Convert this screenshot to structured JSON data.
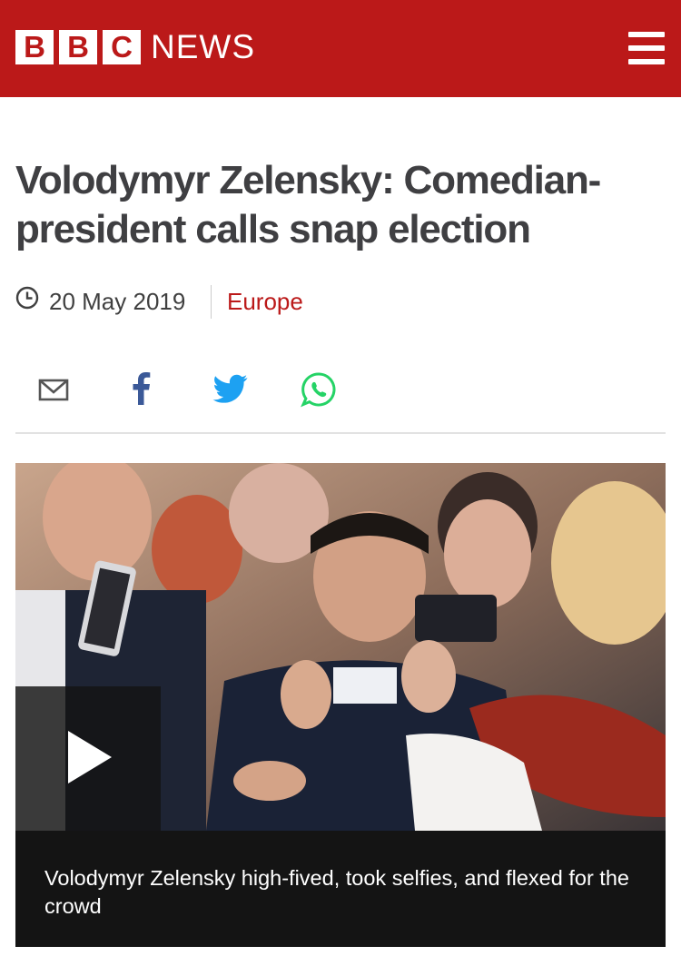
{
  "header": {
    "logo_letters": [
      "B",
      "B",
      "C"
    ],
    "logo_word": "NEWS",
    "menu_icon": "hamburger-menu-icon",
    "background_color": "#bb1919"
  },
  "article": {
    "headline": "Volodymyr Zelensky: Comedian-president calls snap election",
    "date": "20 May 2019",
    "section": "Europe",
    "date_icon": "clock-icon"
  },
  "share": {
    "icons": [
      "email-icon",
      "facebook-icon",
      "twitter-icon",
      "whatsapp-icon"
    ],
    "colors": {
      "facebook": "#3b5998",
      "twitter": "#1da1f2",
      "whatsapp": "#25d366",
      "email": "#555555"
    }
  },
  "media": {
    "type": "video",
    "play_icon": "play-icon",
    "caption": "Volodymyr Zelensky high-fived, took selfies, and flexed for the crowd"
  }
}
